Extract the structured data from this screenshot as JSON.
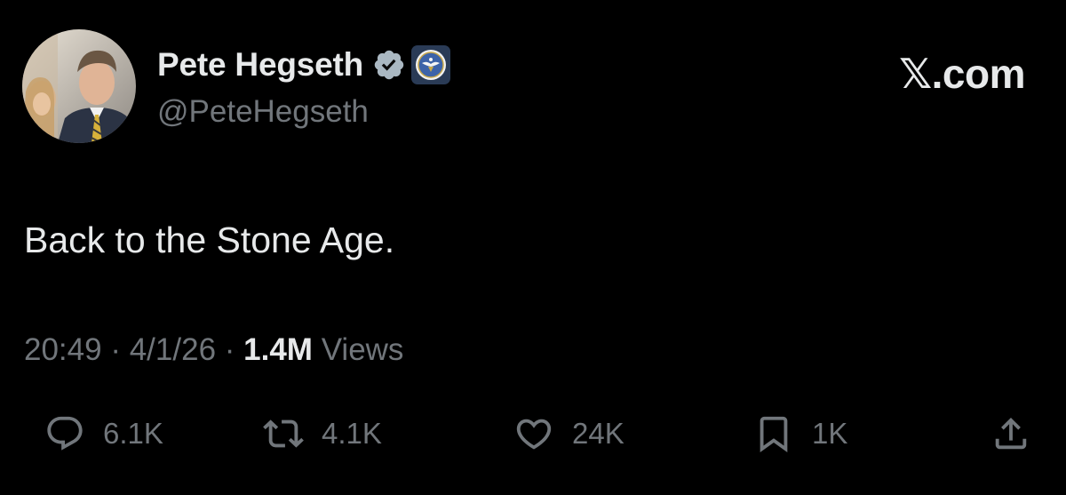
{
  "author": {
    "display_name": "Pete Hegseth",
    "handle": "@PeteHegseth",
    "verified": true,
    "verified_color": "#aab8c2",
    "affiliation_badge": "department-seal-icon"
  },
  "brand": "𝕏.com",
  "tweet": {
    "text": "Back to the Stone Age."
  },
  "meta": {
    "time": "20:49",
    "separator": "·",
    "date": "4/1/26",
    "views_count": "1.4M",
    "views_label": "Views"
  },
  "actions": {
    "replies": {
      "icon": "reply-icon",
      "count": "6.1K"
    },
    "reposts": {
      "icon": "retweet-icon",
      "count": "4.1K"
    },
    "likes": {
      "icon": "heart-icon",
      "count": "24K"
    },
    "bookmarks": {
      "icon": "bookmark-icon",
      "count": "1K"
    },
    "share": {
      "icon": "share-icon"
    }
  },
  "colors": {
    "background": "#000000",
    "primary_text": "#e7e9ea",
    "secondary_text": "#71767b"
  }
}
